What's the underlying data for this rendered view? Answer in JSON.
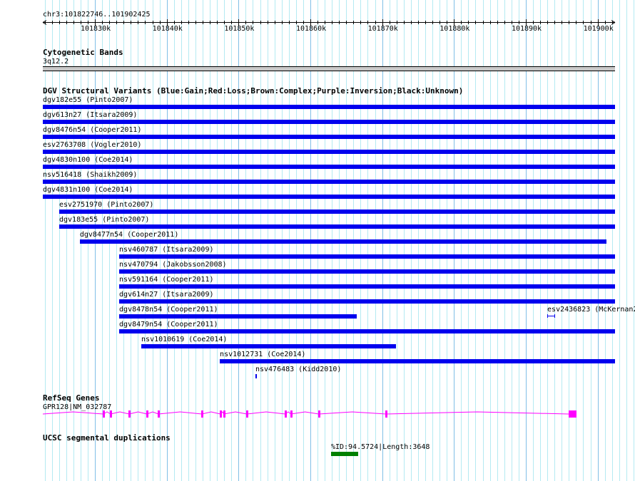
{
  "ruler": {
    "location": "chr3:101822746..101902425",
    "start": 101822746,
    "end": 101902425,
    "tick_labels": [
      "101830k",
      "101840k",
      "101850k",
      "101860k",
      "101870k",
      "101880k",
      "101890k",
      "101900k"
    ]
  },
  "cytoband": {
    "title": "Cytogenetic Bands",
    "band": "3q12.2"
  },
  "dgv": {
    "title": "DGV Structural Variants (Blue:Gain;Red:Loss;Brown:Complex;Purple:Inversion;Black:Unknown)",
    "color": "#0000ee",
    "items": [
      {
        "label": "dgv182e55 (Pinto2007)",
        "start": 101822746,
        "end": 101902425,
        "row": 0
      },
      {
        "label": "dgv613n27 (Itsara2009)",
        "start": 101822746,
        "end": 101902425,
        "row": 1
      },
      {
        "label": "dgv8476n54 (Cooper2011)",
        "start": 101822746,
        "end": 101902425,
        "row": 2
      },
      {
        "label": "esv2763708 (Vogler2010)",
        "start": 101822746,
        "end": 101902425,
        "row": 3
      },
      {
        "label": "dgv4830n100 (Coe2014)",
        "start": 101822746,
        "end": 101902425,
        "row": 4
      },
      {
        "label": "nsv516418 (Shaikh2009)",
        "start": 101822746,
        "end": 101902425,
        "row": 5
      },
      {
        "label": "dgv4831n100 (Coe2014)",
        "start": 101822746,
        "end": 101902425,
        "row": 6
      },
      {
        "label": "esv2751970 (Pinto2007)",
        "start": 101825030,
        "end": 101902425,
        "row": 7
      },
      {
        "label": "dgv183e55 (Pinto2007)",
        "start": 101825030,
        "end": 101902425,
        "row": 8
      },
      {
        "label": "dgv8477n54 (Cooper2011)",
        "start": 101827900,
        "end": 101901230,
        "row": 9
      },
      {
        "label": "nsv460787 (Itsara2009)",
        "start": 101833380,
        "end": 101902425,
        "row": 10
      },
      {
        "label": "nsv470794 (Jakobsson2008)",
        "start": 101833380,
        "end": 101902425,
        "row": 11
      },
      {
        "label": "nsv591164 (Cooper2011)",
        "start": 101833380,
        "end": 101902425,
        "row": 12
      },
      {
        "label": "dgv614n27 (Itsara2009)",
        "start": 101833380,
        "end": 101902425,
        "row": 13
      },
      {
        "label": "dgv8478n54 (Cooper2011)",
        "start": 101833380,
        "end": 101866460,
        "row": 14
      },
      {
        "label": "esv2436823 (McKernan2",
        "start": 101892990,
        "end": 101894080,
        "row": 14,
        "small": true
      },
      {
        "label": "dgv8479n54 (Cooper2011)",
        "start": 101833380,
        "end": 101902425,
        "row": 15
      },
      {
        "label": "nsv1010619 (Coe2014)",
        "start": 101836460,
        "end": 101871920,
        "row": 16
      },
      {
        "label": "nsv1012731 (Coe2014)",
        "start": 101847390,
        "end": 101902425,
        "row": 17
      },
      {
        "label": "nsv476483 (Kidd2010)",
        "start": 101852350,
        "end": 101852550,
        "row": 18
      }
    ]
  },
  "refseq": {
    "title": "RefSeq Genes",
    "gene": "GPR128|NM_032787",
    "color": "#ff00ff"
  },
  "segdup": {
    "title": "UCSC segmental duplications",
    "label": "%ID:94.5724|Length:3648",
    "start": 101862880,
    "end": 101866660,
    "color": "#008000"
  }
}
